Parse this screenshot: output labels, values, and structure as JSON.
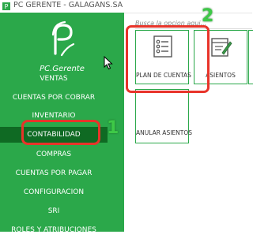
{
  "window": {
    "title": "PC GERENTE - GALAGANS.SA"
  },
  "brand": {
    "name": "PC.Gerente"
  },
  "sidebar": {
    "items": [
      {
        "label": "VENTAS",
        "active": false
      },
      {
        "label": "CUENTAS POR COBRAR",
        "active": false
      },
      {
        "label": "INVENTARIO",
        "active": false
      },
      {
        "label": "CONTABILIDAD",
        "active": true
      },
      {
        "label": "COMPRAS",
        "active": false
      },
      {
        "label": "CUENTAS POR PAGAR",
        "active": false
      },
      {
        "label": "CONFIGURACION",
        "active": false
      },
      {
        "label": "SRI",
        "active": false
      },
      {
        "label": "ROLES Y ATRIBUCIONES",
        "active": false
      }
    ]
  },
  "search": {
    "placeholder": "Busca la opcion aqui..."
  },
  "tiles": [
    {
      "label": "PLAN DE CUENTAS",
      "icon": "list-icon"
    },
    {
      "label": "ASIENTOS",
      "icon": "notebook-pencil-icon"
    },
    {
      "label": "ANULAR ASIENTOS",
      "icon": ""
    }
  ],
  "annotations": [
    {
      "number": "1",
      "color": "#3ec947"
    },
    {
      "number": "2",
      "color": "#3ec947"
    }
  ],
  "colors": {
    "accent": "#2ba84a",
    "active": "#0f6a23",
    "highlight": "#e8342a"
  }
}
